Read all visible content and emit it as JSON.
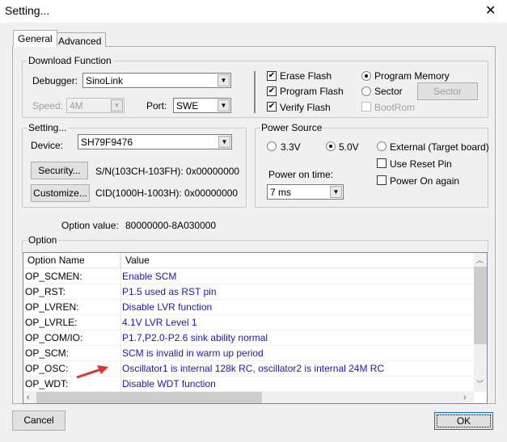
{
  "window": {
    "title": "Setting...",
    "close_icon": "close-icon"
  },
  "tabs": [
    {
      "label": "General",
      "active": true
    },
    {
      "label": "Advanced",
      "active": false
    }
  ],
  "download": {
    "legend": "Download Function",
    "debugger_label": "Debugger:",
    "debugger_value": "SinoLink",
    "speed_label": "Speed:",
    "speed_value": "4M",
    "port_label": "Port:",
    "port_value": "SWE",
    "checks": [
      {
        "label": "Erase Flash",
        "checked": true
      },
      {
        "label": "Program Flash",
        "checked": true
      },
      {
        "label": "Verify Flash",
        "checked": true
      }
    ],
    "radios": [
      {
        "label": "Program Memory",
        "selected": true
      },
      {
        "label": "Sector",
        "selected": false
      }
    ],
    "bootrom": {
      "label": "BootRom",
      "checked": false,
      "disabled": true
    },
    "sector_button": "Sector"
  },
  "setting": {
    "legend": "Setting...",
    "device_label": "Device:",
    "device_value": "SH79F9476",
    "security_button": "Security...",
    "sn_text": "S/N(103CH-103FH): 0x00000000",
    "customize_button": "Customize...",
    "cid_text": "CID(1000H-1003H): 0x00000000"
  },
  "power": {
    "legend": "Power Source",
    "radios": [
      {
        "label": "3.3V",
        "selected": false
      },
      {
        "label": "5.0V",
        "selected": true
      },
      {
        "label": "External (Target board)",
        "selected": false
      }
    ],
    "use_reset_pin": {
      "label": "Use Reset Pin",
      "checked": false
    },
    "power_on_again": {
      "label": "Power On again",
      "checked": false
    },
    "time_label": "Power on time:",
    "time_value": "7 ms"
  },
  "option_value": {
    "label": "Option value:",
    "value": "80000000-8A030000"
  },
  "option": {
    "legend": "Option",
    "columns": [
      "Option Name",
      "Value"
    ],
    "rows": [
      [
        "OP_SCMEN:",
        "Enable SCM"
      ],
      [
        "OP_RST:",
        "P1.5 used as RST pin"
      ],
      [
        "OP_LVREN:",
        "Disable LVR function"
      ],
      [
        "OP_LVRLE:",
        "4.1V LVR Level 1"
      ],
      [
        "OP_COM/IO:",
        "P1.7,P2.0-P2.6 sink ability normal"
      ],
      [
        "OP_SCM:",
        "SCM is invalid in warm up period"
      ],
      [
        "OP_OSC:",
        "Oscillator1 is internal 128k RC, oscillator2 is internal 24M RC"
      ],
      [
        "OP_WDT:",
        "Disable WDT function"
      ]
    ]
  },
  "footer": {
    "cancel": "Cancel",
    "ok": "OK"
  },
  "colors": {
    "value_text": "#1a1ab4",
    "annotation_arrow": "#e53030"
  }
}
